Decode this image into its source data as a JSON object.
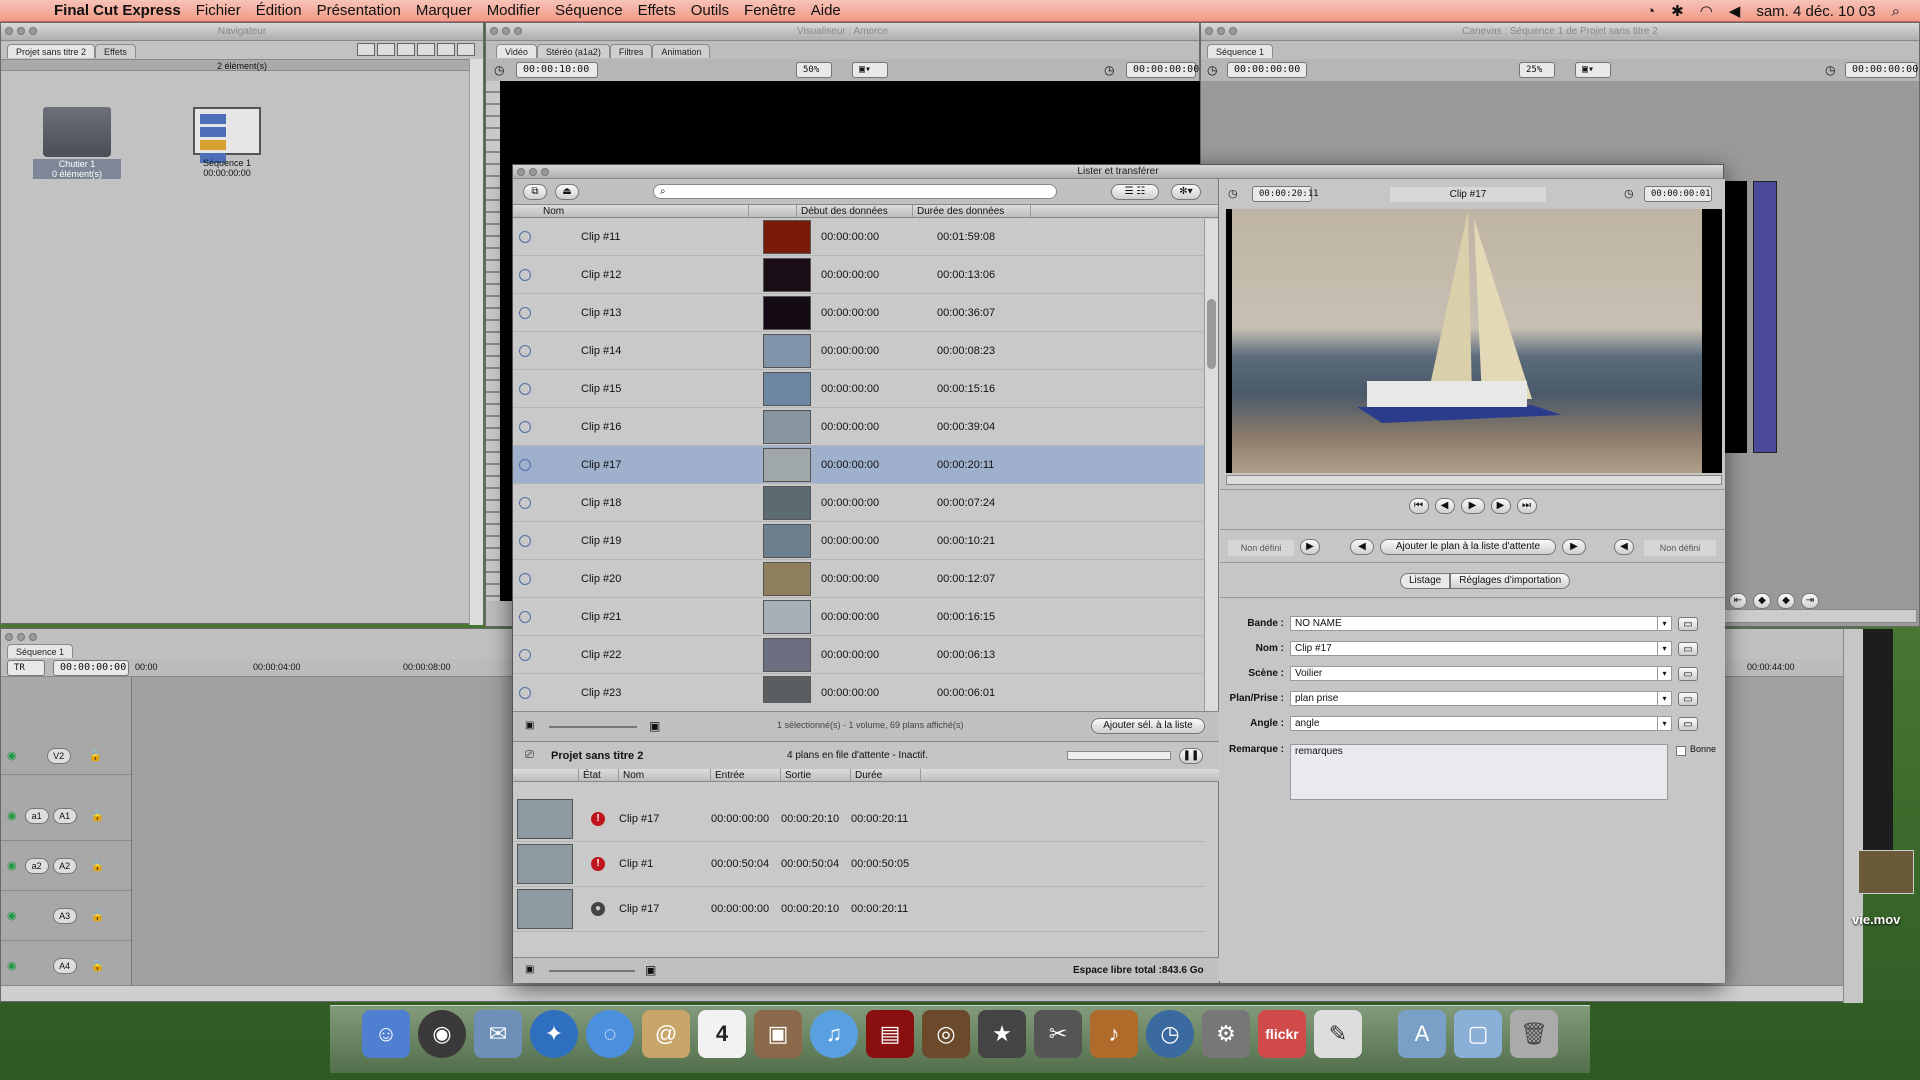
{
  "menubar": {
    "app": "Final Cut Express",
    "items": [
      "Fichier",
      "Édition",
      "Présentation",
      "Marquer",
      "Modifier",
      "Séquence",
      "Effets",
      "Outils",
      "Fenêtre",
      "Aide"
    ],
    "clock": "sam. 4 déc.  10 03"
  },
  "browser": {
    "title": "Navigateur",
    "tabs": [
      "Projet sans titre 2",
      "Effets"
    ],
    "count": "2 élément(s)",
    "items": [
      {
        "name": "Chutier 1",
        "sub": "0 élément(s)"
      },
      {
        "name": "Séquence 1",
        "sub": "00:00:00:00"
      }
    ]
  },
  "viewer": {
    "title": "Visualiseur : Amorce",
    "tabs": [
      "Vidéo",
      "Stéréo (a1a2)",
      "Filtres",
      "Animation"
    ],
    "tc_left": "00:00:10:00",
    "zoom": "50%",
    "tc_right": "00:00:00:00"
  },
  "canvas": {
    "title": "Canevas : Séquence 1 de Projet sans titre 2",
    "tab": "Séquence 1",
    "tc_left": "00:00:00:00",
    "zoom": "25%",
    "tc_right": "00:00:00:00"
  },
  "timeline": {
    "tab": "Séquence 1",
    "mode": "TR",
    "tc": "00:00:00:00",
    "ruler": [
      "00:00",
      "00:00:04:00",
      "00:00:08:00",
      "00:00:44:00"
    ],
    "tracks": [
      {
        "src": "",
        "dst": "V2"
      },
      {
        "src": "a1",
        "dst": "A1"
      },
      {
        "src": "a2",
        "dst": "A2"
      },
      {
        "src": "",
        "dst": "A3"
      },
      {
        "src": "",
        "dst": "A4"
      }
    ]
  },
  "log": {
    "title": "Lister et transférer",
    "columns": [
      "Nom",
      "Début des données",
      "Durée des données"
    ],
    "clips": [
      {
        "name": "Clip #11",
        "start": "00:00:00:00",
        "dur": "00:01:59:08",
        "thumb": "#7a1a08"
      },
      {
        "name": "Clip #12",
        "start": "00:00:00:00",
        "dur": "00:00:13:06",
        "thumb": "#1b0d16"
      },
      {
        "name": "Clip #13",
        "start": "00:00:00:00",
        "dur": "00:00:36:07",
        "thumb": "#140a14"
      },
      {
        "name": "Clip #14",
        "start": "00:00:00:00",
        "dur": "00:00:08:23",
        "thumb": "#7f94a8"
      },
      {
        "name": "Clip #15",
        "start": "00:00:00:00",
        "dur": "00:00:15:16",
        "thumb": "#6d86a2"
      },
      {
        "name": "Clip #16",
        "start": "00:00:00:00",
        "dur": "00:00:39:04",
        "thumb": "#8796a1"
      },
      {
        "name": "Clip #17",
        "start": "00:00:00:00",
        "dur": "00:00:20:11",
        "thumb": "#a0a7a8"
      },
      {
        "name": "Clip #18",
        "start": "00:00:00:00",
        "dur": "00:00:07:24",
        "thumb": "#5c6a72"
      },
      {
        "name": "Clip #19",
        "start": "00:00:00:00",
        "dur": "00:00:10:21",
        "thumb": "#6d8090"
      },
      {
        "name": "Clip #20",
        "start": "00:00:00:00",
        "dur": "00:00:12:07",
        "thumb": "#8f7f5c"
      },
      {
        "name": "Clip #21",
        "start": "00:00:00:00",
        "dur": "00:00:16:15",
        "thumb": "#a5b1b6"
      },
      {
        "name": "Clip #22",
        "start": "00:00:00:00",
        "dur": "00:00:06:13",
        "thumb": "#6b6f80"
      },
      {
        "name": "Clip #23",
        "start": "00:00:00:00",
        "dur": "00:00:06:01",
        "thumb": "#5b5e60"
      }
    ],
    "status": "1 sélectionné(s) - 1 volume, 69 plans affiché(s)",
    "add_selected": "Ajouter sél. à la liste",
    "project": "Projet sans titre 2",
    "queue_status": "4 plans en file d'attente - Inactif.",
    "queue_columns": [
      "État",
      "Nom",
      "Entrée",
      "Sortie",
      "Durée"
    ],
    "queue": [
      {
        "name": "Clip #17",
        "in": "00:00:00:00",
        "out": "00:00:20:10",
        "dur": "00:00:20:11",
        "state": "!"
      },
      {
        "name": "Clip #1",
        "in": "00:00:50:04",
        "out": "00:00:50:04",
        "dur": "00:00:50:05",
        "state": "!"
      },
      {
        "name": "Clip #17",
        "in": "00:00:00:00",
        "out": "00:00:20:10",
        "dur": "00:00:20:11",
        "state": "●"
      }
    ],
    "free_space": "Espace libre total :843.6 Go",
    "preview": {
      "tc_in": "00:00:20:11",
      "clip": "Clip #17",
      "tc_out": "00:00:00:01"
    },
    "undef_left": "Non défini",
    "undef_right": "Non défini",
    "add_to_queue": "Ajouter le plan à la liste d'attente",
    "subtabs": [
      "Listage",
      "Réglages d'importation"
    ],
    "fields": {
      "bande_label": "Bande :",
      "bande": "NO NAME",
      "nom_label": "Nom :",
      "nom": "Clip #17",
      "scene_label": "Scène :",
      "scene": "Voilier",
      "plan_label": "Plan/Prise :",
      "plan": "plan prise",
      "angle_label": "Angle :",
      "angle": "angle",
      "remarque_label": "Remarque :",
      "remarque": "remarques",
      "bonne": "Bonne"
    }
  },
  "desktop": {
    "file": "vie.mov"
  },
  "dock": {
    "flickr": "flickr",
    "cal_day": "4"
  }
}
